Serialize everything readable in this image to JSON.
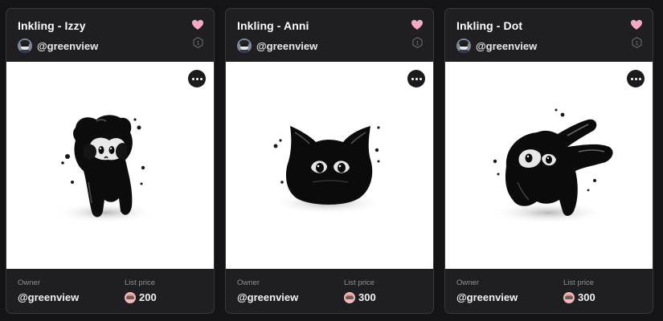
{
  "cards": [
    {
      "title": "Inkling - Izzy",
      "creator": "@greenview",
      "edition": "1",
      "owner_label": "Owner",
      "owner": "@greenview",
      "price_label": "List price",
      "price": "200",
      "liked": true,
      "artwork": "black ink creature standing, hands on cheeks"
    },
    {
      "title": "Inkling - Anni",
      "creator": "@greenview",
      "edition": "1",
      "owner_label": "Owner",
      "owner": "@greenview",
      "price_label": "List price",
      "price": "300",
      "liked": true,
      "artwork": "round black ink cat blob"
    },
    {
      "title": "Inkling - Dot",
      "creator": "@greenview",
      "edition": "1",
      "owner_label": "Owner",
      "owner": "@greenview",
      "price_label": "List price",
      "price": "300",
      "liked": true,
      "artwork": "black ink creature with long floppy ears"
    }
  ],
  "colors": {
    "background": "#141416",
    "card": "#1f1f22",
    "border": "#38383d",
    "heart": "#f5a9c2",
    "muted_text": "#8e8e95",
    "token": "#f3b8b8"
  },
  "icons": [
    "heart-icon",
    "edition-hexagon-icon",
    "more-options-icon",
    "token-icon"
  ]
}
